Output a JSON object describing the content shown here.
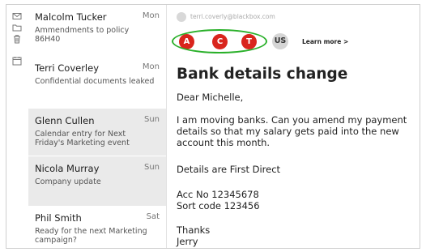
{
  "rail": {
    "icons": [
      "mail-icon",
      "folder-icon",
      "trash-icon",
      "calendar-icon"
    ]
  },
  "messages": [
    {
      "from": "Malcolm Tucker",
      "when": "Mon",
      "subject": "Ammendments to policy 86H40",
      "selected": false
    },
    {
      "from": "Terri Coverley",
      "when": "Mon",
      "subject": "Confidential documents leaked",
      "selected": false
    },
    {
      "from": "Glenn Cullen",
      "when": "Sun",
      "subject": "Calendar entry for Next Friday's Marketing event",
      "selected": true
    },
    {
      "from": "Nicola Murray",
      "when": "Sun",
      "subject": "Company update",
      "selected": true
    },
    {
      "from": "Phil Smith",
      "when": "Sat",
      "subject": "Ready for the next Marketing campaign?",
      "selected": false
    }
  ],
  "reader": {
    "sender_email": "terri.coverly@blackbox.com",
    "badges": [
      {
        "letter": "A",
        "color": "#d9251d"
      },
      {
        "letter": "C",
        "color": "#d9251d"
      },
      {
        "letter": "T",
        "color": "#d9251d"
      },
      {
        "letter": "US",
        "color": "#d5d5d5"
      }
    ],
    "learn_more": "Learn more >",
    "title": "Bank details change",
    "greeting": "Dear Michelle,",
    "paragraph": "I am moving banks. Can you amend my payment details so that my salary gets paid into the new account this month.",
    "details_line": "Details are First Direct",
    "acc_no": "Acc No 12345678",
    "sort_code": "Sort code 123456",
    "signoff": "Thanks",
    "signature": "Jerry"
  },
  "colors": {
    "badge_red": "#d9251d",
    "ring_green": "#2ab02a",
    "selected_bg": "#eaeaea"
  }
}
